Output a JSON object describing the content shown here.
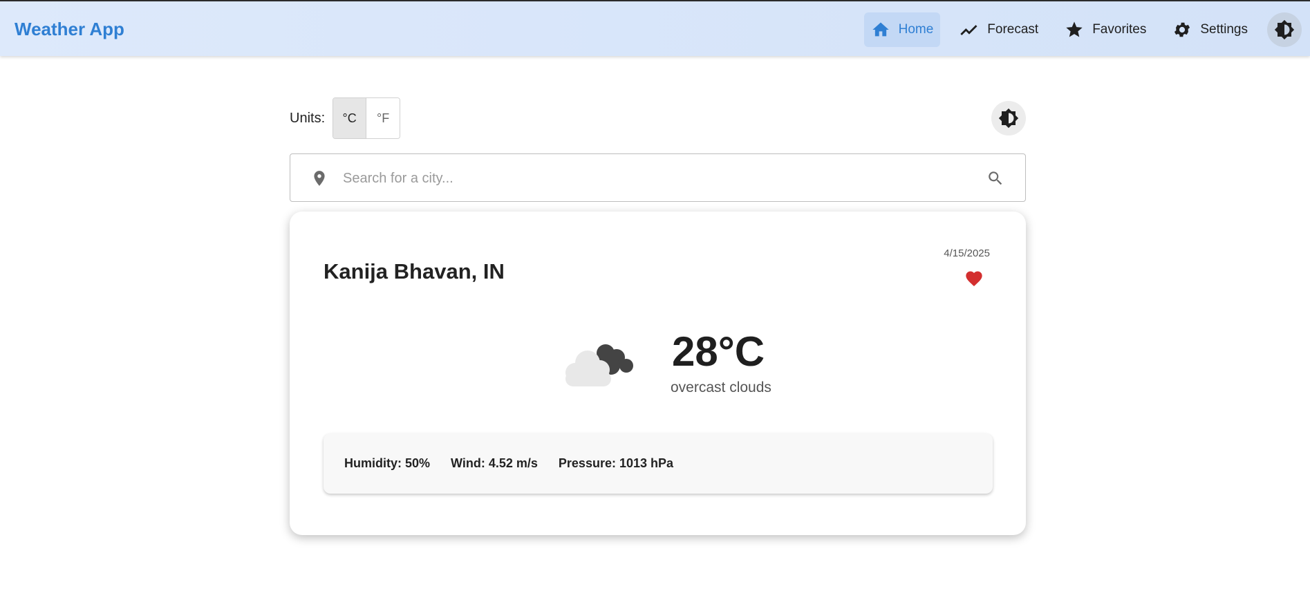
{
  "app": {
    "title": "Weather App",
    "accent": "#2f7fd3"
  },
  "nav": {
    "items": [
      {
        "label": "Home",
        "icon": "home-icon",
        "active": true
      },
      {
        "label": "Forecast",
        "icon": "trending-icon",
        "active": false
      },
      {
        "label": "Favorites",
        "icon": "star-icon",
        "active": false
      },
      {
        "label": "Settings",
        "icon": "gear-icon",
        "active": false
      }
    ],
    "theme_icon": "brightness-icon"
  },
  "units": {
    "label": "Units:",
    "options": [
      "°C",
      "°F"
    ],
    "selected": "°C"
  },
  "search": {
    "placeholder": "Search for a city...",
    "value": ""
  },
  "weather": {
    "city": "Kanija Bhavan, IN",
    "date": "4/15/2025",
    "favorite": true,
    "favorite_color": "#d32f2f",
    "icon": "overcast-clouds-icon",
    "temperature": "28°C",
    "description": "overcast clouds",
    "details": {
      "humidity": "Humidity: 50%",
      "wind": "Wind: 4.52 m/s",
      "pressure": "Pressure: 1013 hPa"
    }
  }
}
